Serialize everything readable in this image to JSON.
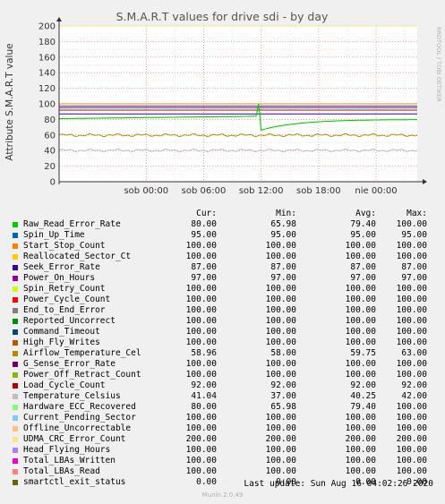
{
  "chart_data": {
    "type": "line",
    "title": "S.M.A.R.T values for drive sdi - by day",
    "ylabel": "Attribute S.M.A.R.T value",
    "ylim": [
      0,
      200
    ],
    "yticks": [
      0,
      20,
      40,
      60,
      80,
      100,
      120,
      140,
      160,
      180,
      200
    ],
    "xticks": [
      "sob 00:00",
      "sob 06:00",
      "sob 12:00",
      "sob 18:00",
      "nie 00:00"
    ],
    "x_start_hour": -9.1,
    "x_end_hour": 28.3,
    "x_tick_hours": [
      0,
      6,
      12,
      18,
      24
    ],
    "vertical_marker_hours": [
      3,
      9,
      15,
      21,
      27
    ],
    "grid": true,
    "legend_columns": [
      "Cur:",
      "Min:",
      "Avg:",
      "Max:"
    ],
    "series": [
      {
        "name": "Raw_Read_Error_Rate",
        "color": "#00cc00",
        "cur": "80.00",
        "min": "65.98",
        "avg": "79.40",
        "max": "100.00"
      },
      {
        "name": "Spin_Up_Time",
        "color": "#0066b3",
        "cur": "95.00",
        "min": "95.00",
        "avg": "95.00",
        "max": "95.00"
      },
      {
        "name": "Start_Stop_Count",
        "color": "#ff8000",
        "cur": "100.00",
        "min": "100.00",
        "avg": "100.00",
        "max": "100.00"
      },
      {
        "name": "Reallocated_Sector_Ct",
        "color": "#ffcc00",
        "cur": "100.00",
        "min": "100.00",
        "avg": "100.00",
        "max": "100.00"
      },
      {
        "name": "Seek_Error_Rate",
        "color": "#330099",
        "cur": "87.00",
        "min": "87.00",
        "avg": "87.00",
        "max": "87.00"
      },
      {
        "name": "Power_On_Hours",
        "color": "#990099",
        "cur": "97.00",
        "min": "97.00",
        "avg": "97.00",
        "max": "97.00"
      },
      {
        "name": "Spin_Retry_Count",
        "color": "#ccff00",
        "cur": "100.00",
        "min": "100.00",
        "avg": "100.00",
        "max": "100.00"
      },
      {
        "name": "Power_Cycle_Count",
        "color": "#ff0000",
        "cur": "100.00",
        "min": "100.00",
        "avg": "100.00",
        "max": "100.00"
      },
      {
        "name": "End_to_End_Error",
        "color": "#808080",
        "cur": "100.00",
        "min": "100.00",
        "avg": "100.00",
        "max": "100.00"
      },
      {
        "name": "Reported_Uncorrect",
        "color": "#008f00",
        "cur": "100.00",
        "min": "100.00",
        "avg": "100.00",
        "max": "100.00"
      },
      {
        "name": "Command_Timeout",
        "color": "#00487d",
        "cur": "100.00",
        "min": "100.00",
        "avg": "100.00",
        "max": "100.00"
      },
      {
        "name": "High_Fly_Writes",
        "color": "#b35a00",
        "cur": "100.00",
        "min": "100.00",
        "avg": "100.00",
        "max": "100.00"
      },
      {
        "name": "Airflow_Temperature_Cel",
        "color": "#b38f00",
        "cur": "58.96",
        "min": "58.00",
        "avg": "59.75",
        "max": "63.00"
      },
      {
        "name": "G_Sense_Error_Rate",
        "color": "#6b006b",
        "cur": "100.00",
        "min": "100.00",
        "avg": "100.00",
        "max": "100.00"
      },
      {
        "name": "Power_Off_Retract_Count",
        "color": "#8fb300",
        "cur": "100.00",
        "min": "100.00",
        "avg": "100.00",
        "max": "100.00"
      },
      {
        "name": "Load_Cycle_Count",
        "color": "#b30000",
        "cur": "92.00",
        "min": "92.00",
        "avg": "92.00",
        "max": "92.00"
      },
      {
        "name": "Temperature_Celsius",
        "color": "#bebebe",
        "cur": "41.04",
        "min": "37.00",
        "avg": "40.25",
        "max": "42.00"
      },
      {
        "name": "Hardware_ECC_Recovered",
        "color": "#80ff80",
        "cur": "80.00",
        "min": "65.98",
        "avg": "79.40",
        "max": "100.00"
      },
      {
        "name": "Current_Pending_Sector",
        "color": "#80c9ff",
        "cur": "100.00",
        "min": "100.00",
        "avg": "100.00",
        "max": "100.00"
      },
      {
        "name": "Offline_Uncorrectable",
        "color": "#ffc080",
        "cur": "100.00",
        "min": "100.00",
        "avg": "100.00",
        "max": "100.00"
      },
      {
        "name": "UDMA_CRC_Error_Count",
        "color": "#ffe680",
        "cur": "200.00",
        "min": "200.00",
        "avg": "200.00",
        "max": "200.00"
      },
      {
        "name": "Head_Flying_Hours",
        "color": "#aa80ff",
        "cur": "100.00",
        "min": "100.00",
        "avg": "100.00",
        "max": "100.00"
      },
      {
        "name": "Total_LBAs_Written",
        "color": "#ee00cc",
        "cur": "100.00",
        "min": "100.00",
        "avg": "100.00",
        "max": "100.00"
      },
      {
        "name": "Total_LBAs_Read",
        "color": "#ff8080",
        "cur": "100.00",
        "min": "100.00",
        "avg": "100.00",
        "max": "100.00"
      },
      {
        "name": "smartctl_exit_status",
        "color": "#666600",
        "cur": "0.00",
        "min": "0.00",
        "avg": "0.00",
        "max": "0.00"
      }
    ]
  },
  "last_update": "Last update: Sun Aug 16 04:02:26 2020",
  "footer": "Munin 2.0.49",
  "watermark": "RRDTOOL / TOBI OETIKER"
}
